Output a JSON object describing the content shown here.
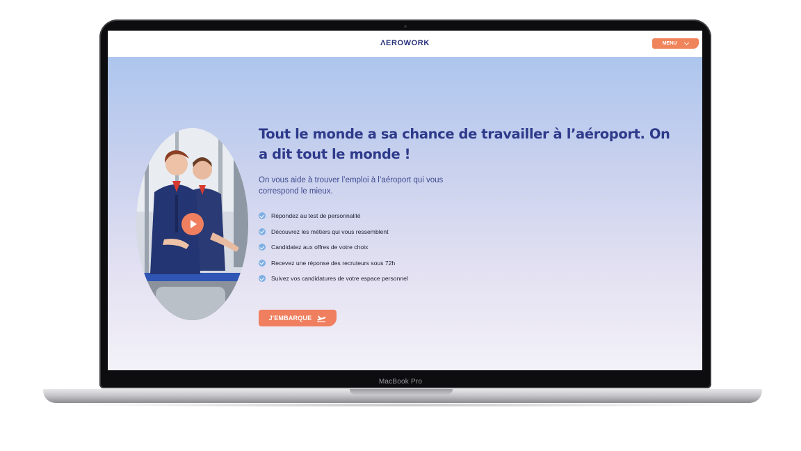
{
  "device": {
    "bezel_label": "MacBook Pro"
  },
  "header": {
    "logo": "ΛEROWORK",
    "menu_label": "MENU"
  },
  "hero": {
    "title": "Tout le monde a sa chance de travailler à l’aéroport. On a dit tout le monde !",
    "subtitle": "On vous aide à trouver l’emploi à l’aéroport qui vous correspond le mieux.",
    "features": [
      "Répondez au test de personnalité",
      "Découvrez les métiers qui vous ressemblent",
      "Candidatez aux offres de votre choix",
      "Recevez une réponse des recruteurs sous 72h",
      "Suivez vos candidatures de votre espace personnel"
    ],
    "cta_label": "J'EMBARQUE",
    "cta_icon": "airplane-departure-icon",
    "video_icon": "play-icon"
  },
  "colors": {
    "accent": "#ef7f5e",
    "title": "#2e3a8a",
    "check": "#7fb0e4"
  }
}
